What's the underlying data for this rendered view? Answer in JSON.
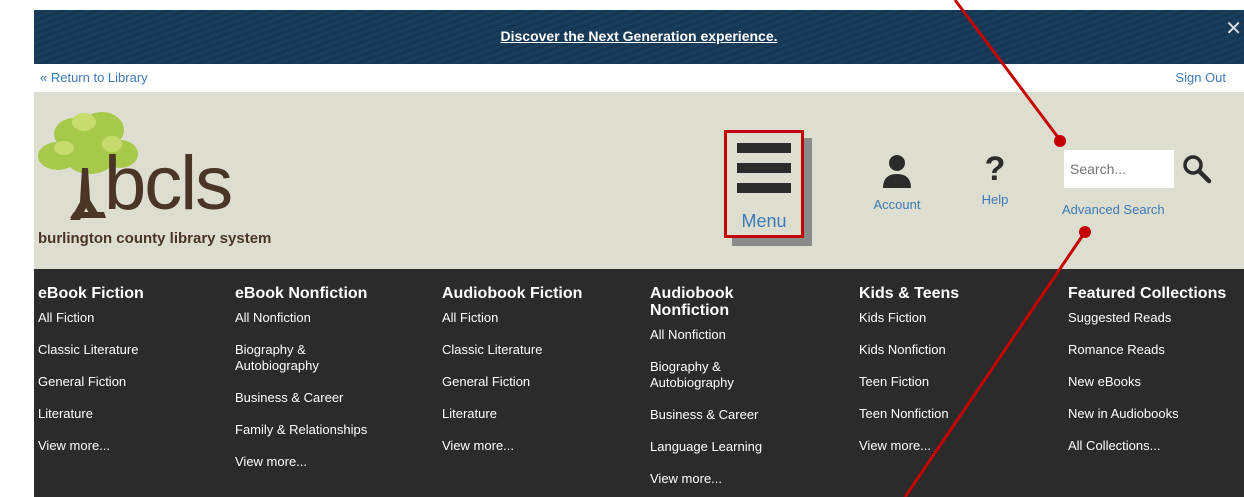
{
  "banner": {
    "link_text": "Discover the Next Generation experience.",
    "close_glyph": "✕"
  },
  "topstrip": {
    "return_text": "« Return to Library",
    "signout_text": "Sign Out"
  },
  "logo": {
    "brand": "bcls",
    "subtitle": "burlington county library system"
  },
  "header": {
    "menu_label": "Menu",
    "account_label": "Account",
    "help_label": "Help",
    "help_glyph": "?",
    "search_placeholder": "Search...",
    "advanced_search": "Advanced Search"
  },
  "columns": [
    {
      "title": "eBook Fiction",
      "items": [
        "All Fiction",
        "Classic Literature",
        "General Fiction",
        "Literature",
        "View more..."
      ]
    },
    {
      "title": "eBook Nonfiction",
      "items": [
        "All Nonfiction",
        "Biography & Autobiography",
        "Business & Career",
        "Family & Relationships",
        "View more..."
      ]
    },
    {
      "title": "Audiobook Fiction",
      "items": [
        "All Fiction",
        "Classic Literature",
        "General Fiction",
        "Literature",
        "View more..."
      ]
    },
    {
      "title": "Audiobook Nonfiction",
      "items": [
        "All Nonfiction",
        "Biography & Autobiography",
        "Business & Career",
        "Language Learning",
        "View more..."
      ]
    },
    {
      "title": "Kids & Teens",
      "items": [
        "Kids Fiction",
        "Kids Nonfiction",
        "Teen Fiction",
        "Teen Nonfiction",
        "View more..."
      ]
    },
    {
      "title": "Featured Collections",
      "items": [
        "Suggested Reads",
        "Romance Reads",
        "New eBooks",
        "New in Audiobooks",
        "All Collections..."
      ]
    }
  ],
  "colors": {
    "banner": "#1a3d5c",
    "header": "#ddddd0",
    "dark_menu": "#2b2b2b",
    "link": "#3d7ab8",
    "annotation": "#c40000"
  }
}
